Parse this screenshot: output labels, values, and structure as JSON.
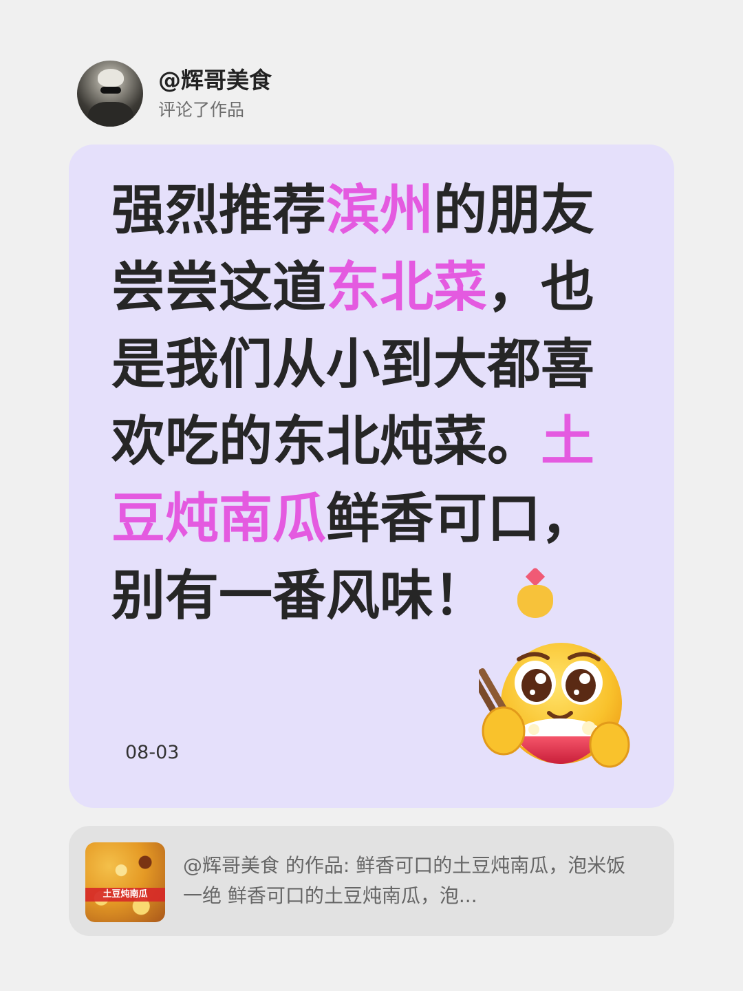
{
  "header": {
    "user_name": "@辉哥美食",
    "action": "评论了作品",
    "avatar": "user-avatar"
  },
  "comment": {
    "segments": [
      {
        "text": "强烈推荐",
        "highlight": false
      },
      {
        "text": "滨州",
        "highlight": true
      },
      {
        "text": "的朋友尝尝这道",
        "highlight": false
      },
      {
        "text": "东北菜",
        "highlight": true
      },
      {
        "text": "，也是我们从小到大都喜欢吃的东北炖菜。",
        "highlight": false
      },
      {
        "text": "土豆炖南瓜",
        "highlight": true
      },
      {
        "text": "鲜香可口，别有一番风味！",
        "highlight": false
      }
    ],
    "trailing_emoji": "finger-heart-emoji",
    "sticker": "eating-rice-bowl-emoji",
    "date": "08-03",
    "highlight_color": "#e45ae0",
    "card_color": "#e5e0fb"
  },
  "post": {
    "thumbnail_label": "土豆炖南瓜",
    "description": "@辉哥美食 的作品: 鲜香可口的土豆炖南瓜，泡米饭一绝 鲜香可口的土豆炖南瓜，泡..."
  }
}
